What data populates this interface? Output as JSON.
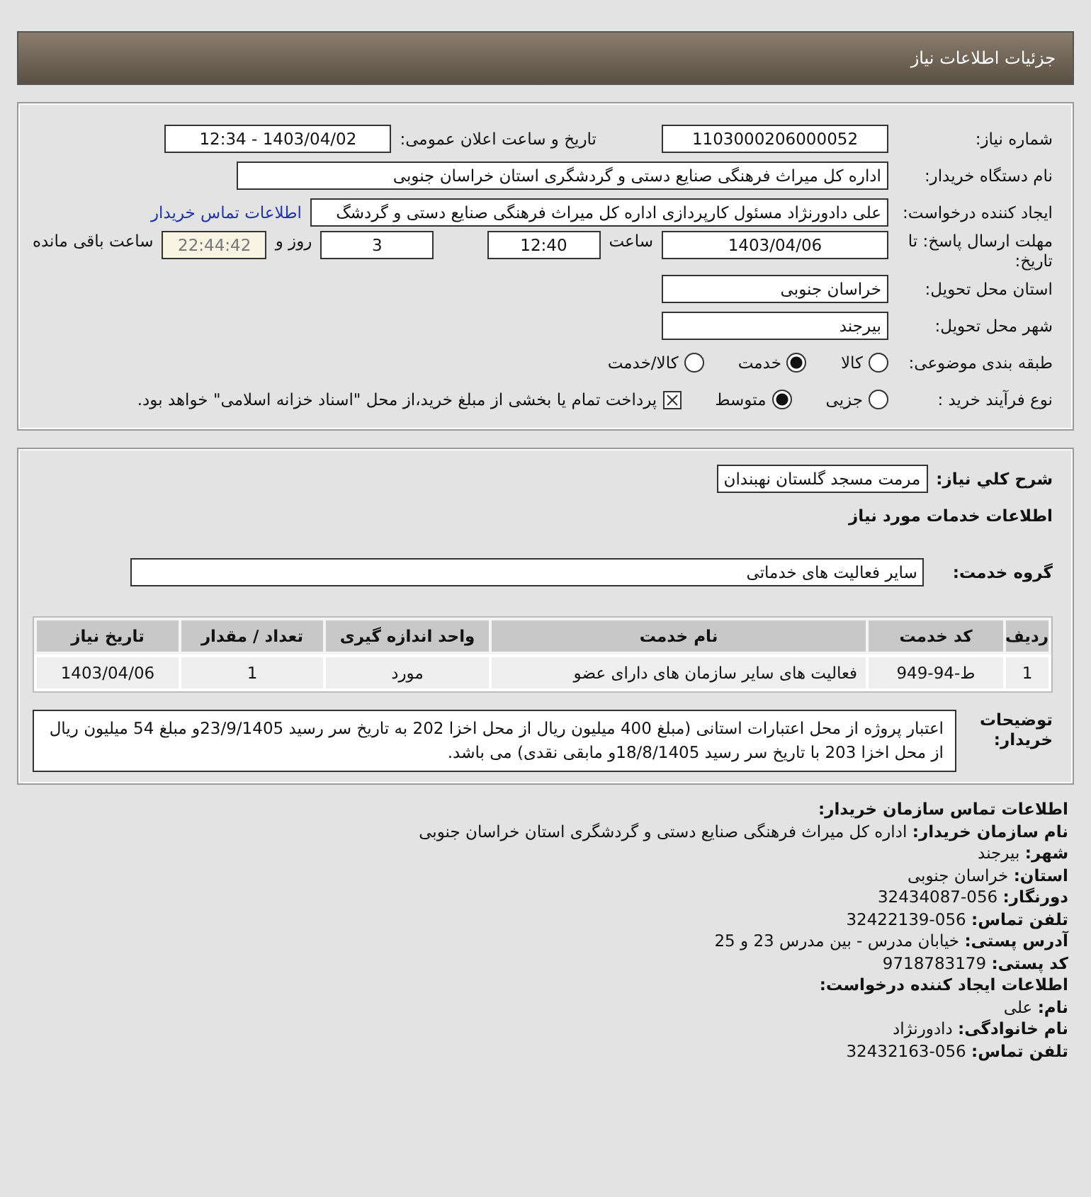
{
  "header": {
    "title": "جزئیات اطلاعات نیاز"
  },
  "need_number": {
    "label": "شماره نیاز:",
    "value": "1103000206000052"
  },
  "announce": {
    "label": "تاریخ و ساعت اعلان عمومی:",
    "value": "1403/04/02 - 12:34"
  },
  "buyer": {
    "label": "نام دستگاه خریدار:",
    "value": "اداره کل میراث فرهنگی  صنایع دستی و گردشگری استان خراسان جنوبی"
  },
  "requester": {
    "label": "ایجاد کننده درخواست:",
    "value": "علی دادورنژاد مسئول کارپردازی اداره کل میراث فرهنگی  صنایع دستی و گردشگ",
    "link": "اطلاعات تماس خریدار"
  },
  "deadline": {
    "label": "مهلت ارسال پاسخ: تا تاریخ:",
    "date": "1403/04/06",
    "time_label": "ساعت",
    "time": "12:40",
    "days": "3",
    "days_label": "روز و",
    "remaining": "22:44:42",
    "remaining_label": "ساعت باقی مانده"
  },
  "province": {
    "label": "استان محل تحویل:",
    "value": "خراسان جنوبی"
  },
  "city": {
    "label": "شهر محل تحویل:",
    "value": "بیرجند"
  },
  "category": {
    "label": "طبقه بندی موضوعی:",
    "options": [
      {
        "label": "کالا",
        "selected": false
      },
      {
        "label": "خدمت",
        "selected": true
      },
      {
        "label": "کالا/خدمت",
        "selected": false
      }
    ]
  },
  "process": {
    "label": "نوع فرآیند خرید :",
    "options": [
      {
        "label": "جزیی",
        "selected": false
      },
      {
        "label": "متوسط",
        "selected": true
      }
    ],
    "payment": {
      "label": "پرداخت تمام یا بخشی از مبلغ خرید،از محل \"اسناد خزانه اسلامی\" خواهد بود.",
      "checked": true
    }
  },
  "summary": {
    "label": "شرح کلي نياز:",
    "value": "مرمت مسجد گلستان نهبندان"
  },
  "services_title": "اطلاعات خدمات مورد نیاز",
  "service_group": {
    "label": "گروه خدمت:",
    "value": "سایر فعالیت های خدماتی"
  },
  "table": {
    "columns": [
      "ردیف",
      "کد خدمت",
      "نام خدمت",
      "واحد اندازه گیری",
      "تعداد / مقدار",
      "تاریخ نیاز"
    ],
    "rows": [
      [
        "1",
        "ط-94-949",
        "فعالیت های سایر سازمان های دارای عضو",
        "مورد",
        "1",
        "1403/04/06"
      ]
    ]
  },
  "notes": {
    "label": "توضیحات خریدار:",
    "text": "اعتبار پروژه از محل اعتبارات استانی (مبلغ 400 میلیون ریال از محل اخزا 202 به تاریخ سر رسید 23/9/1405و مبلغ 54 میلیون ریال از محل اخزا 203 با تاریخ سر رسید 18/8/1405و مابقی نقدی) می باشد."
  },
  "contact": [
    {
      "kind": "title",
      "text": "اطلاعات تماس سازمان خریدار:"
    },
    {
      "kind": "line",
      "text": "**نام سازمان خریدار:** اداره کل میراث فرهنگی صنایع دستی و گردشگری استان خراسان جنوبی"
    },
    {
      "kind": "line",
      "text": "**شهر:** بیرجند"
    },
    {
      "kind": "line",
      "text": "**استان:** خراسان جنوبی"
    },
    {
      "kind": "line",
      "text": "**دورنگار:** 056-32434087"
    },
    {
      "kind": "line",
      "text": "**تلفن تماس:** 056-32422139"
    },
    {
      "kind": "line",
      "text": "**آدرس پستی:** خیابان مدرس - بین مدرس 23 و 25"
    },
    {
      "kind": "line",
      "text": "**کد پستی:** 9718783179"
    },
    {
      "kind": "title",
      "text": "اطلاعات ایجاد کننده درخواست:"
    },
    {
      "kind": "line",
      "text": "**نام:** علی"
    },
    {
      "kind": "line",
      "text": "**نام خانوادگی:** دادورنژاد"
    },
    {
      "kind": "line",
      "text": "**تلفن تماس:** 056-32432163"
    }
  ]
}
